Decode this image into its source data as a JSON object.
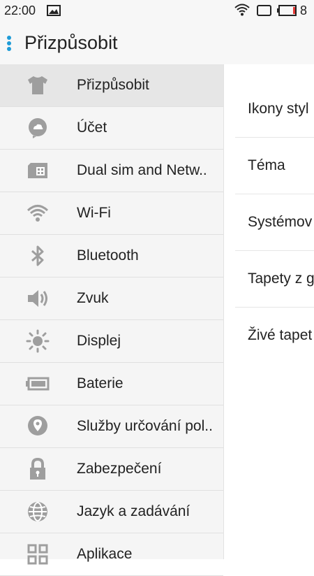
{
  "status_bar": {
    "time": "22:00",
    "battery_level": "8",
    "icons": [
      "image-icon",
      "wifi-icon",
      "sim-icon",
      "battery-icon"
    ]
  },
  "app_bar": {
    "title": "Přizpůsobit",
    "accent_color": "#1e9bd7"
  },
  "sidebar": {
    "items": [
      {
        "label": "Přizpůsobit",
        "icon": "shirt-icon",
        "selected": true
      },
      {
        "label": "Účet",
        "icon": "account-cloud-icon",
        "selected": false
      },
      {
        "label": "Dual sim and Netw..",
        "icon": "sim-card-icon",
        "selected": false
      },
      {
        "label": "Wi-Fi",
        "icon": "wifi-icon",
        "selected": false
      },
      {
        "label": "Bluetooth",
        "icon": "bluetooth-icon",
        "selected": false
      },
      {
        "label": "Zvuk",
        "icon": "speaker-icon",
        "selected": false
      },
      {
        "label": "Displej",
        "icon": "brightness-icon",
        "selected": false
      },
      {
        "label": "Baterie",
        "icon": "battery-icon",
        "selected": false
      },
      {
        "label": "Služby určování pol..",
        "icon": "location-pin-icon",
        "selected": false
      },
      {
        "label": "Zabezpečení",
        "icon": "lock-icon",
        "selected": false
      },
      {
        "label": "Jazyk a zadávání",
        "icon": "globe-icon",
        "selected": false
      },
      {
        "label": "Aplikace",
        "icon": "apps-grid-icon",
        "selected": false
      }
    ]
  },
  "panel": {
    "items": [
      {
        "label": "Ikony styl"
      },
      {
        "label": "Téma"
      },
      {
        "label": "Systémov"
      },
      {
        "label": "Tapety z g"
      },
      {
        "label": "Živé tapet"
      }
    ]
  }
}
